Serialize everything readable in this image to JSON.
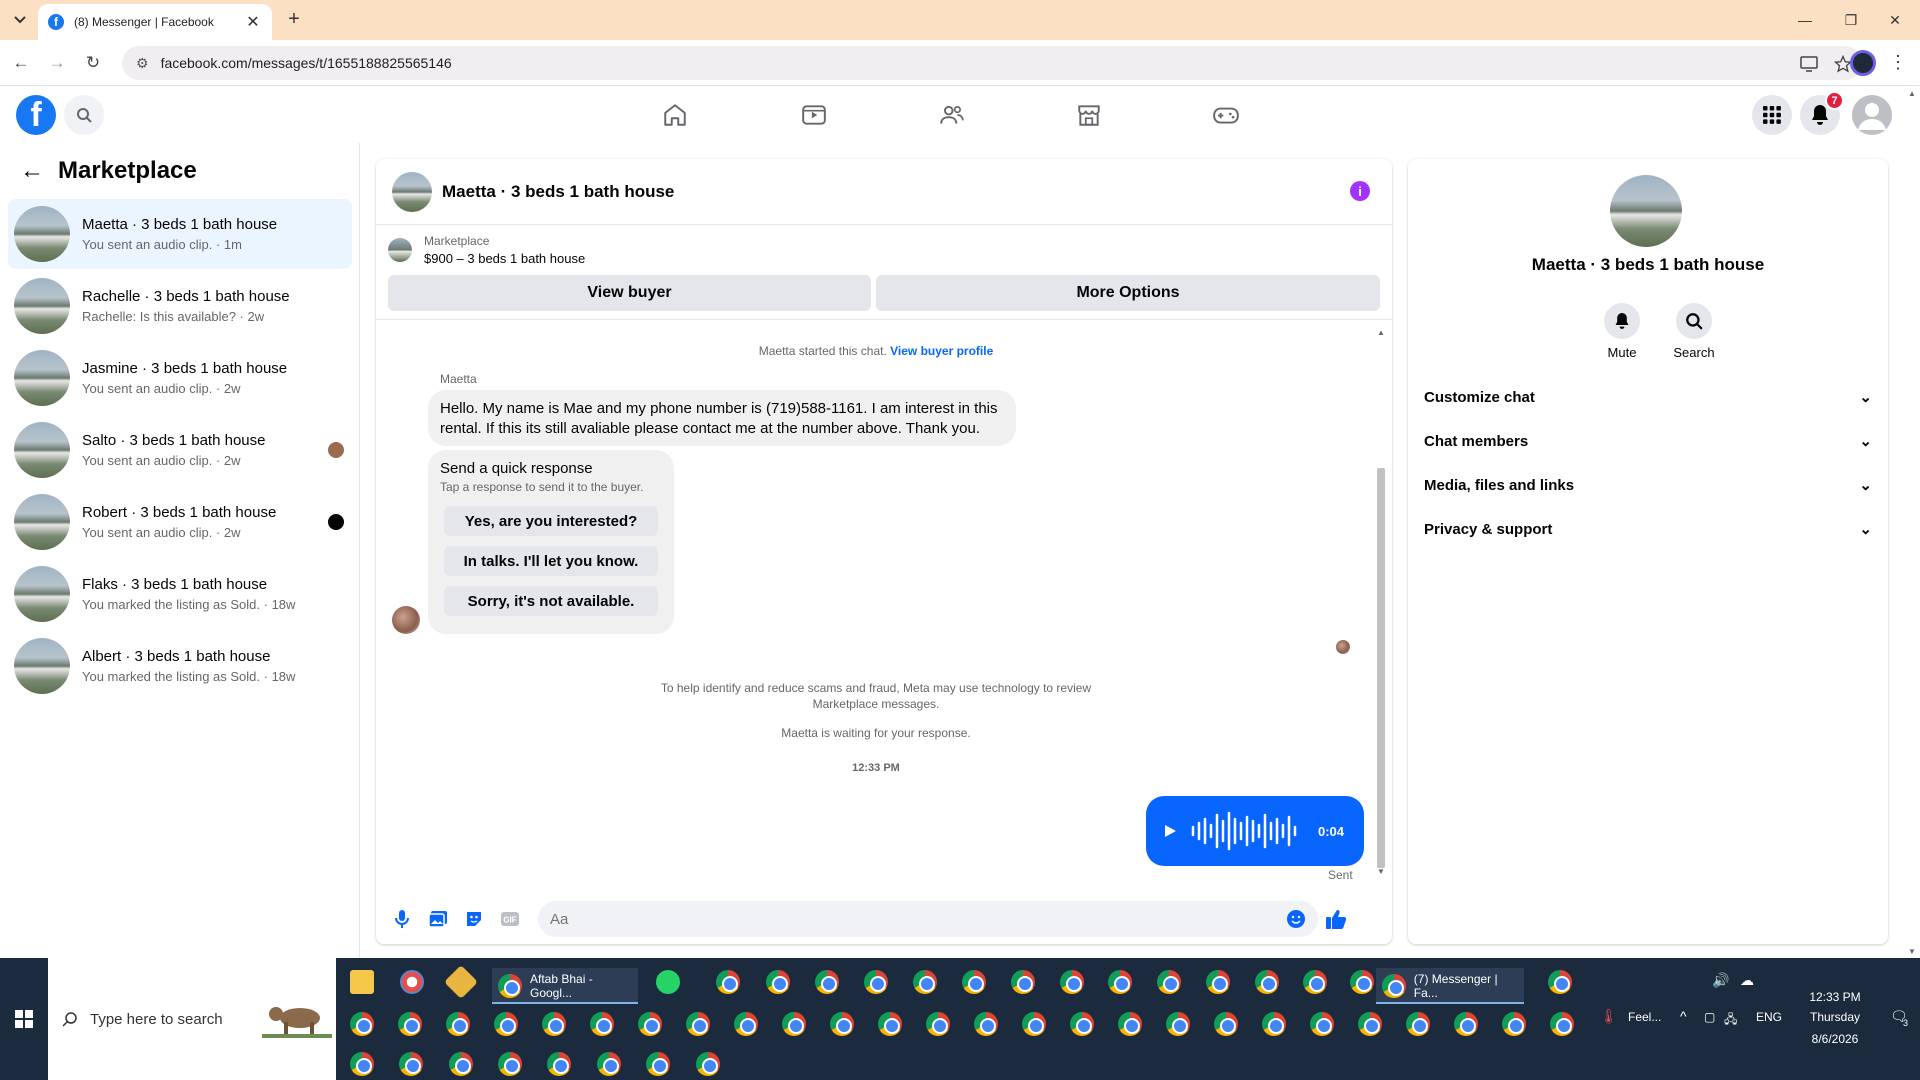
{
  "browser": {
    "tab_title": "(8) Messenger | Facebook",
    "url": "facebook.com/messages/t/1655188825565146",
    "new_tab_label": "+",
    "close_tab_label": "✕"
  },
  "fb": {
    "notification_count": "7",
    "nav": [
      "home",
      "watch",
      "friends",
      "marketplace",
      "gaming"
    ]
  },
  "sidebar": {
    "title": "Marketplace",
    "conversations": [
      {
        "name": "Maetta · 3 beds 1 bath house",
        "preview": "You sent an audio clip. · 1m",
        "active": true
      },
      {
        "name": "Rachelle · 3 beds 1 bath house",
        "preview": "Rachelle: Is this available? · 2w"
      },
      {
        "name": "Jasmine · 3 beds 1 bath house",
        "preview": "You sent an audio clip. · 2w"
      },
      {
        "name": "Salto · 3 beds 1 bath house",
        "preview": "You sent an audio clip. · 2w"
      },
      {
        "name": "Robert · 3 beds 1 bath house",
        "preview": "You sent an audio clip. · 2w"
      },
      {
        "name": "Flaks · 3 beds 1 bath house",
        "preview": "You marked the listing as Sold. · 18w"
      },
      {
        "name": "Albert · 3 beds 1 bath house",
        "preview": "You marked the listing as Sold. · 18w"
      }
    ]
  },
  "chat": {
    "title": "Maetta · 3 beds 1 bath house",
    "listing_source": "Marketplace",
    "listing_title": "$900 – 3 beds 1 bath house",
    "view_buyer_label": "View buyer",
    "more_options_label": "More Options",
    "started_text": "Maetta started this chat.",
    "view_profile_link": "View buyer profile",
    "sender_name": "Maetta",
    "message_line1": "Hello. My name is Mae and my phone number is (719)588-1161. I am interest in this",
    "message_line2": "rental. If this its still avaliable please contact me at the number above. Thank you.",
    "quick_response_title": "Send a quick response",
    "quick_response_subtitle": "Tap a response to send it to the buyer.",
    "quick_responses": [
      "Yes, are you interested?",
      "In talks. I'll let you know.",
      "Sorry, it's not available."
    ],
    "scam_notice_line1": "To help identify and reduce scams and fraud, Meta may use technology to review",
    "scam_notice_line2": "Marketplace messages.",
    "waiting_text": "Maetta is waiting for your response.",
    "timestamp": "12:33 PM",
    "audio_duration": "0:04",
    "sent_label": "Sent",
    "input_placeholder": "Aa"
  },
  "info_panel": {
    "name": "Maetta · 3 beds 1 bath house",
    "mute_label": "Mute",
    "search_label": "Search",
    "sections": [
      "Customize chat",
      "Chat members",
      "Media, files and links",
      "Privacy & support"
    ]
  },
  "taskbar": {
    "search_placeholder": "Type here to search",
    "task1_label": "Aftab Bhai - Googl...",
    "task2_label": "(7) Messenger | Fa...",
    "weather_label": "Feel...",
    "language": "ENG",
    "time": "12:33 PM",
    "day": "Thursday",
    "date": "8/6/2026",
    "notification_count": "3"
  }
}
